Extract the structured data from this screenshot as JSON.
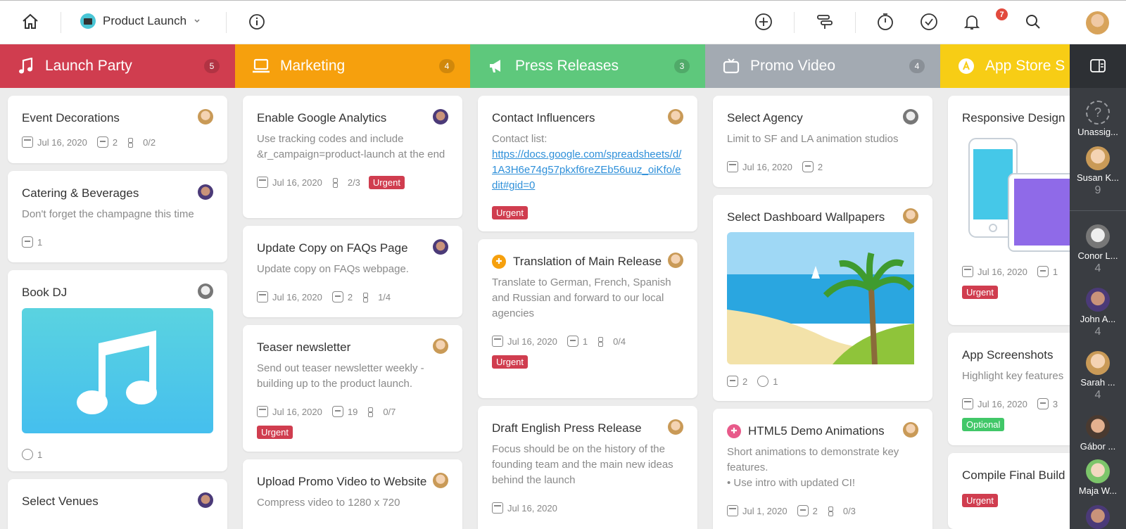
{
  "topbar": {
    "project_name": "Product Launch",
    "notifications_count": "7",
    "icons": [
      "home-icon",
      "info-icon",
      "add-icon",
      "timeline-icon",
      "timer-icon",
      "check-circle-icon",
      "bell-icon",
      "search-icon"
    ]
  },
  "columns": [
    {
      "title": "Launch Party",
      "count": "5",
      "color": "#d03d4f",
      "icon": "music-note-icon",
      "cards": [
        {
          "title": "Event Decorations",
          "date": "Jul 16, 2020",
          "comments": "2",
          "checklist": "0/2"
        },
        {
          "title": "Catering & Beverages",
          "desc": "Don't forget the champagne this time",
          "comments": "1"
        },
        {
          "title": "Book DJ",
          "attachments": "1"
        },
        {
          "title": "Select Venues"
        }
      ]
    },
    {
      "title": "Marketing",
      "count": "4",
      "color": "#f6a00d",
      "icon": "laptop-icon",
      "cards": [
        {
          "title": "Enable Google Analytics",
          "desc": "Use tracking codes and include &r_campaign=product-launch at the end",
          "date": "Jul 16, 2020",
          "checklist": "2/3",
          "tag": "Urgent"
        },
        {
          "title": "Update Copy on FAQs Page",
          "desc": "Update copy on FAQs webpage.",
          "date": "Jul 16, 2020",
          "comments": "2",
          "checklist": "1/4"
        },
        {
          "title": "Teaser newsletter",
          "desc": "Send out teaser newsletter weekly - building up to the product launch.",
          "date": "Jul 16, 2020",
          "comments": "19",
          "checklist": "0/7",
          "tag": "Urgent"
        },
        {
          "title": "Upload Promo Video to Website",
          "desc": "Compress video to 1280 x 720"
        }
      ]
    },
    {
      "title": "Press Releases",
      "count": "3",
      "color": "#5ec87c",
      "icon": "megaphone-icon",
      "cards": [
        {
          "title": "Contact Influencers",
          "desc": "Contact list:",
          "link": "https://docs.google.com/spreadsheets/d/1A3H6e74g57pkxf6reZEb56uuz_oiKfo/edit#gid=0",
          "tag": "Urgent"
        },
        {
          "title": "Translation of Main Release",
          "desc": "Translate to German, French, Spanish and Russian and forward to our local agencies",
          "date": "Jul 16, 2020",
          "comments": "1",
          "checklist": "0/4",
          "tag": "Urgent"
        },
        {
          "title": "Draft English Press Release",
          "desc": "Focus should be on the history of the founding team and the main new ideas behind the launch",
          "date": "Jul 16, 2020"
        }
      ]
    },
    {
      "title": "Promo Video",
      "count": "4",
      "color": "#a3aab2",
      "icon": "tv-icon",
      "cards": [
        {
          "title": "Select Agency",
          "desc": "Limit to SF and LA animation studios",
          "date": "Jul 16, 2020",
          "comments": "2"
        },
        {
          "title": "Select Dashboard Wallpapers",
          "comments": "2",
          "attachments": "1"
        },
        {
          "title": "HTML5 Demo Animations",
          "desc": "Short animations to demonstrate key features.",
          "desc2": "• Use intro with updated CI!",
          "date": "Jul 1, 2020",
          "comments": "2",
          "checklist": "0/3"
        }
      ]
    },
    {
      "title": "App Store S",
      "color": "#f7cd15",
      "icon": "app-store-icon",
      "cards": [
        {
          "title": "Responsive Design",
          "date": "Jul 16, 2020",
          "comments": "1",
          "tag": "Urgent"
        },
        {
          "title": "App Screenshots",
          "desc": "Highlight key features",
          "date": "Jul 16, 2020",
          "comments": "3",
          "tag": "Optional"
        },
        {
          "title": "Compile Final Build",
          "tag": "Urgent"
        }
      ]
    }
  ],
  "assignees": [
    {
      "name": "Unassig...",
      "count": ""
    },
    {
      "name": "Susan K...",
      "count": "9"
    },
    {
      "name": "Conor L...",
      "count": "4"
    },
    {
      "name": "John A...",
      "count": "4"
    },
    {
      "name": "Sarah ...",
      "count": "4"
    },
    {
      "name": "Gábor ...",
      "count": ""
    },
    {
      "name": "Maja W...",
      "count": ""
    }
  ]
}
